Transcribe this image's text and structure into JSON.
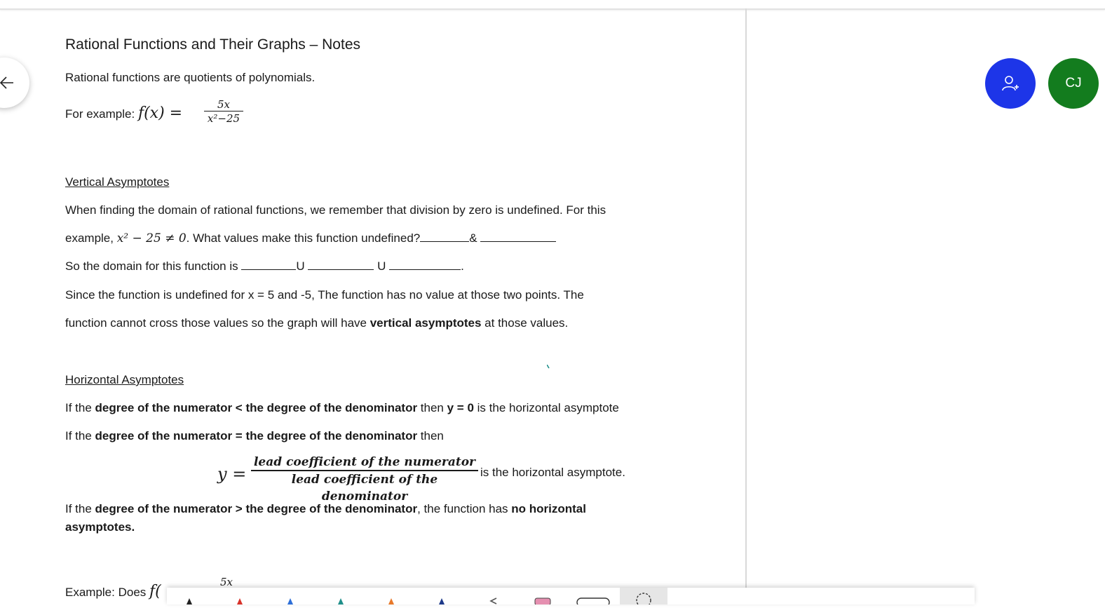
{
  "document": {
    "title": "Rational Functions and Their Graphs – Notes",
    "intro": "Rational functions are quotients of polynomials.",
    "example": {
      "label": "For example: ",
      "lhs": "f(x) =",
      "numerator": "5x",
      "denominator": "x²−25"
    },
    "vertical": {
      "heading": "Vertical Asymptotes",
      "p1": "When finding the domain of rational functions, we remember that division by zero is undefined.  For this",
      "p2_pre": "example, ",
      "p2_math": "x² − 25  ≠ 0",
      "p2_post": ".  What values make this function undefined?",
      "p2_amp": "&",
      "p3": "So the domain for this function is ",
      "union": "U",
      "p3_end": ".",
      "p4": "Since the function is undefined for x = 5 and -5,  The function has no value at those two points.  The",
      "p5_pre": "function cannot cross those values so the graph will have ",
      "p5_bold": "vertical asymptotes",
      "p5_post": " at those values."
    },
    "horizontal": {
      "heading": "Horizontal Asymptotes",
      "r1_pre": "If the ",
      "r1_bold": "degree of the numerator < the degree of the denominator",
      "r1_mid": " then ",
      "r1_bold2": "y = 0",
      "r1_post": " is the horizontal asymptote",
      "r2_pre": "If the ",
      "r2_bold": "degree of the numerator = the degree of the denominator",
      "r2_post": " then",
      "eq_lhs": "y =",
      "eq_num": "lead coefficient of the numerator",
      "eq_den": "lead coefficient of the denominator",
      "eq_post": " is the horizontal asymptote.",
      "r3_pre": "If the ",
      "r3_bold": "degree of the numerator > the degree of the denominator",
      "r3_mid": ", the function has ",
      "r3_bold2": "no horizontal",
      "r3_bold3": "asymptotes."
    },
    "example2": {
      "label": "Example: Does ",
      "fn": "f(",
      "numerator": "5x"
    }
  },
  "controls": {
    "avatar_initials": "CJ",
    "back_icon": "arrow-left-icon",
    "add_user_icon": "add-user-icon"
  },
  "colors": {
    "add_user_bg": "#1d35e8",
    "avatar_bg": "#137c1e",
    "accent_teal": "#1f8f8a"
  },
  "toolbar": {
    "tools": [
      {
        "name": "pen-black",
        "color": "#222222"
      },
      {
        "name": "pen-red",
        "color": "#d8322a"
      },
      {
        "name": "pen-blue",
        "color": "#2e6fd8"
      },
      {
        "name": "pen-teal",
        "color": "#1f8f8a"
      },
      {
        "name": "pen-orange",
        "color": "#e8792a"
      },
      {
        "name": "pen-darkblue",
        "color": "#1e3a8a"
      },
      {
        "name": "eraser",
        "color": "#555555"
      },
      {
        "name": "highlighter-pink",
        "color": "#e58fb0"
      },
      {
        "name": "shape-tool",
        "color": "#333333"
      },
      {
        "name": "lasso-tool",
        "color": "#333333"
      }
    ]
  }
}
